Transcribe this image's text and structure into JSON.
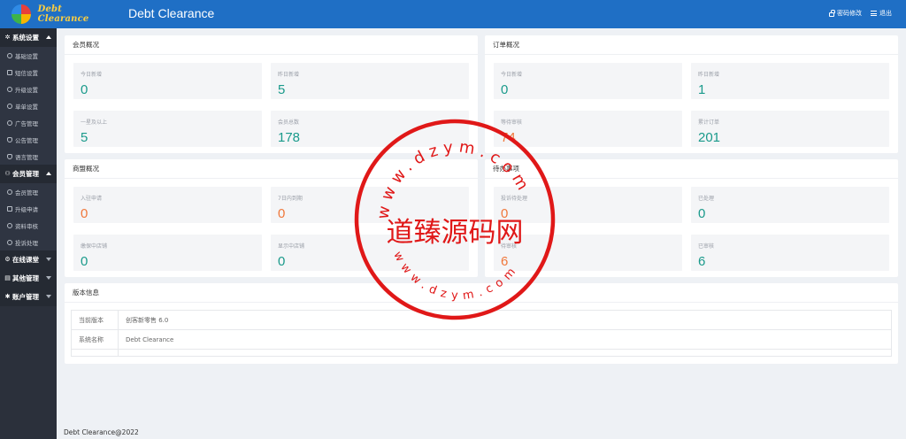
{
  "header": {
    "logo_text": "Debt Clearance",
    "title": "Debt Clearance",
    "actions": [
      {
        "label": "密码修改",
        "icon": "lock-icon"
      },
      {
        "label": "退出",
        "icon": "menu-icon"
      }
    ]
  },
  "sidebar": {
    "groups": [
      {
        "label": "系统设置",
        "icon": "settings-icon",
        "expanded": true,
        "items": [
          "基础设置",
          "短信设置",
          "升级设置",
          "单单设置",
          "广告管理",
          "公告管理",
          "语言管理"
        ]
      },
      {
        "label": "会员管理",
        "icon": "user-icon",
        "expanded": true,
        "items": [
          "会员管理",
          "升级申请",
          "资料审核",
          "投诉处理"
        ]
      },
      {
        "label": "在线课堂",
        "icon": "classroom-icon",
        "expanded": false,
        "items": []
      },
      {
        "label": "其他管理",
        "icon": "other-icon",
        "expanded": false,
        "items": []
      },
      {
        "label": "账户管理",
        "icon": "account-icon",
        "expanded": false,
        "items": []
      }
    ]
  },
  "panels": {
    "members": {
      "title": "会员概况",
      "stats": [
        {
          "label": "今日新增",
          "value": "0"
        },
        {
          "label": "昨日新增",
          "value": "5"
        },
        {
          "label": "一星及以上",
          "value": "5"
        },
        {
          "label": "会员总数",
          "value": "178"
        }
      ]
    },
    "orders": {
      "title": "订单概况",
      "stats": [
        {
          "label": "今日新增",
          "value": "0"
        },
        {
          "label": "昨日新增",
          "value": "1"
        },
        {
          "label": "等待审核",
          "value": "74"
        },
        {
          "label": "累计订单",
          "value": "201"
        }
      ]
    },
    "merchants": {
      "title": "商盟概况",
      "stats": [
        {
          "label": "入驻申请",
          "value": "0"
        },
        {
          "label": "7日内到期",
          "value": "0"
        },
        {
          "label": "缴保中店铺",
          "value": "0"
        },
        {
          "label": "显示中店铺",
          "value": "0"
        }
      ]
    },
    "todo": {
      "title": "待办事项",
      "stats": [
        {
          "label": "投诉待处理",
          "value": "0"
        },
        {
          "label": "已处理",
          "value": "0"
        },
        {
          "label": "待审核",
          "value": "6"
        },
        {
          "label": "已审核",
          "value": "6"
        }
      ]
    },
    "version": {
      "title": "版本信息",
      "rows": [
        {
          "key": "当前版本",
          "value": "创客新零售 6.0"
        },
        {
          "key": "系统名称",
          "value": "Debt Clearance"
        }
      ]
    }
  },
  "footer": {
    "text": "Debt Clearance@2022"
  },
  "watermark": {
    "center_text": "道臻源码网",
    "top_text": "www.dzym.com",
    "bottom_text": "www.dzym.com",
    "color": "#e01818"
  },
  "colors": {
    "header": "#1f6fc5",
    "sidebar": "#2b303b",
    "teal": "#1a9a8b",
    "orange": "#f0783b"
  }
}
